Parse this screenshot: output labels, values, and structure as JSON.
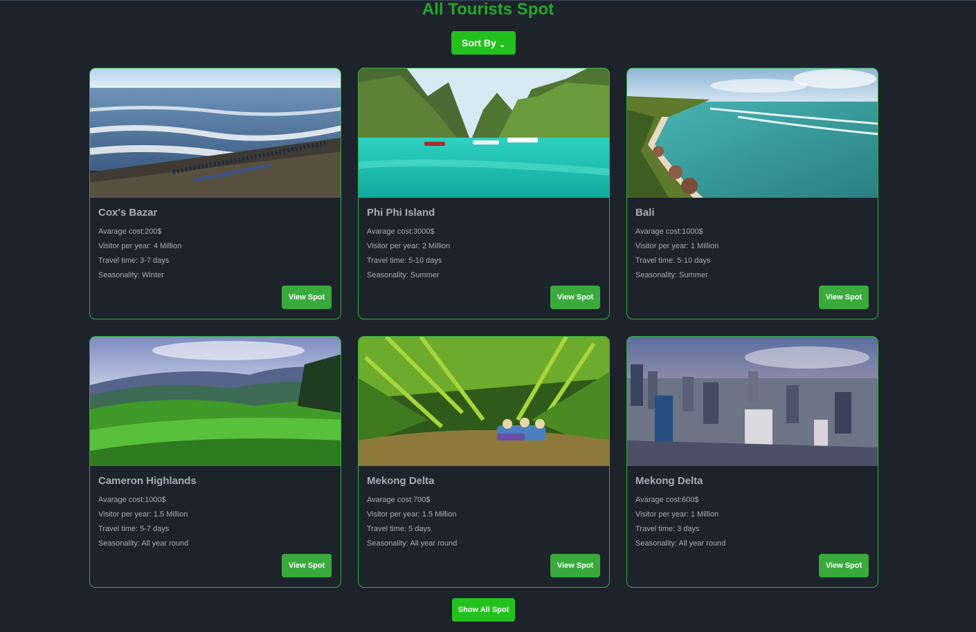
{
  "page": {
    "title": "All Tourists Spot"
  },
  "toolbar": {
    "sort_label": "Sort By",
    "sort_icon": "chevron-down-icon"
  },
  "spots": [
    {
      "name": "Cox's Bazar",
      "cost": "Avarage cost:200$",
      "visitors": "Visitor per year: 4 Million",
      "travel": "Travel time: 3-7 days",
      "season": "Seasonality: Winter",
      "button": "View Spot"
    },
    {
      "name": "Phi Phi Island",
      "cost": "Avarage cost:3000$",
      "visitors": "Visitor per year: 2 Million",
      "travel": "Travel time: 5-10 days",
      "season": "Seasonality: Summer",
      "button": "View Spot"
    },
    {
      "name": "Bali",
      "cost": "Avarage cost:1000$",
      "visitors": "Visitor per year: 1 Million",
      "travel": "Travel time: 5-10 days",
      "season": "Seasonality: Summer",
      "button": "View Spot"
    },
    {
      "name": "Cameron Highlands",
      "cost": "Avarage cost:1000$",
      "visitors": "Visitor per year: 1.5 Million",
      "travel": "Travel time: 5-7 days",
      "season": "Seasonality: All year round",
      "button": "View Spot"
    },
    {
      "name": "Mekong Delta",
      "cost": "Avarage cost:700$",
      "visitors": "Visitor per year: 1.5 Million",
      "travel": "Travel time: 5 days",
      "season": "Seasonality: All year round",
      "button": "View Spot"
    },
    {
      "name": "Mekong Delta",
      "cost": "Avarage cost:600$",
      "visitors": "Visitor per year: 1 Million",
      "travel": "Travel time: 3 days",
      "season": "Seasonality: All year round",
      "button": "View Spot"
    }
  ],
  "footer": {
    "show_all_label": "Show All Spot"
  },
  "colors": {
    "background": "#1d232a",
    "accent": "#24c01d",
    "title": "#23a82b",
    "card_border": "#2fb23a",
    "button": "#3aaa3c"
  }
}
